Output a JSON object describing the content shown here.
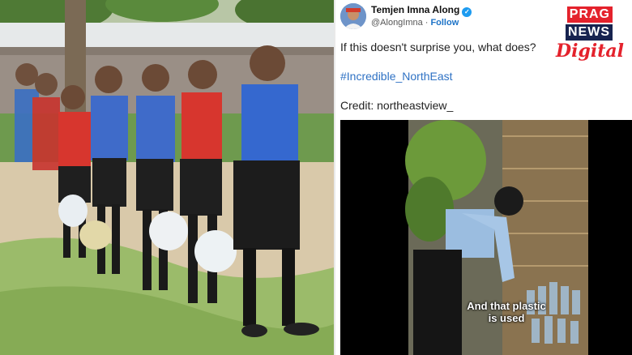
{
  "tweet": {
    "display_name": "Temjen Imna Along",
    "handle": "@AlongImna",
    "separator": "·",
    "follow_label": "Follow",
    "text": "If this doesn't surprise you, what does?",
    "hashtag": "#Incredible_NorthEast",
    "credit": "Credit: northeastview_"
  },
  "brand": {
    "line1": "PRAG",
    "line2": "NEWS",
    "line3": "Digital"
  },
  "video": {
    "caption_line1": "And that plastic",
    "caption_line2": "is used"
  },
  "icons": {
    "verified": "verified-badge-icon",
    "avatar": "profile-avatar"
  },
  "colors": {
    "brand_red": "#e4222c",
    "brand_navy": "#17234f",
    "link_blue": "#2f72c4",
    "verified_blue": "#1d9bf0"
  }
}
